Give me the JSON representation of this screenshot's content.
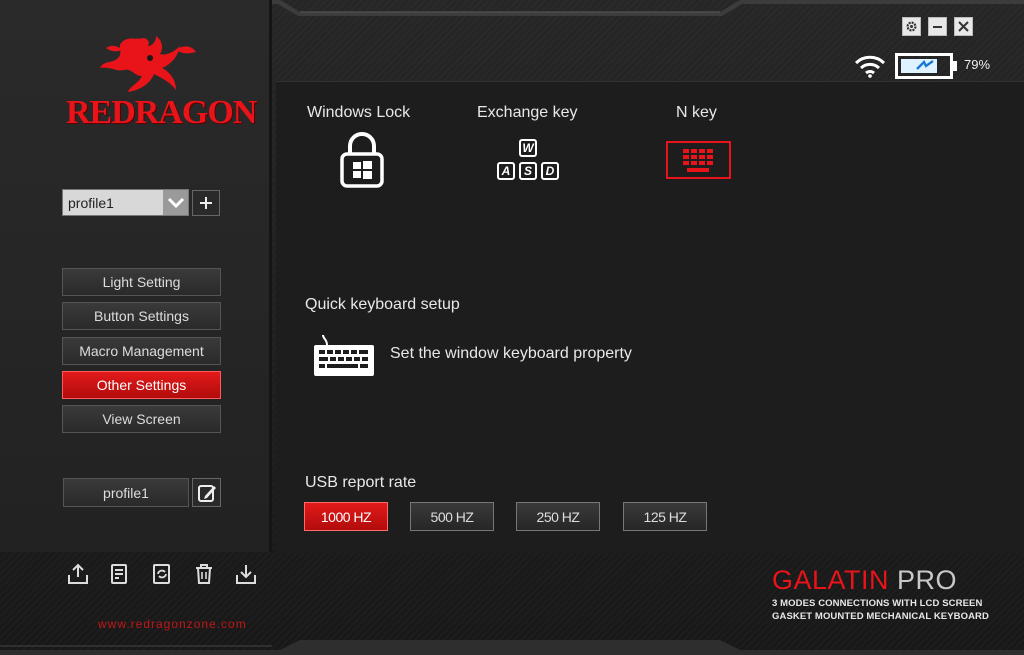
{
  "brand": {
    "name": "REDRAGON",
    "url": "www.redragonzone.com"
  },
  "profile_select": {
    "value": "profile1"
  },
  "nav": [
    {
      "label": "Light Setting",
      "active": false
    },
    {
      "label": "Button Settings",
      "active": false
    },
    {
      "label": "Macro Management",
      "active": false
    },
    {
      "label": "Other Settings",
      "active": true
    },
    {
      "label": "View Screen",
      "active": false
    }
  ],
  "profile_name": "profile1",
  "battery": {
    "percent_text": "79%",
    "level": 0.79
  },
  "features": {
    "windows_lock": "Windows Lock",
    "exchange_key": "Exchange key",
    "n_key": "N key",
    "wasd": [
      "W",
      "A",
      "S",
      "D"
    ]
  },
  "quick_setup": {
    "title": "Quick keyboard setup",
    "description": "Set the window keyboard property"
  },
  "usb_rate": {
    "title": "USB report rate",
    "options": [
      {
        "label": "1000 HZ",
        "active": true
      },
      {
        "label": "500 HZ",
        "active": false
      },
      {
        "label": "250 HZ",
        "active": false
      },
      {
        "label": "125 HZ",
        "active": false
      }
    ]
  },
  "product": {
    "name": "GALATIN",
    "suffix": "PRO",
    "tagline1": "3 MODES CONNECTIONS WITH LCD SCREEN",
    "tagline2": "GASKET MOUNTED MECHANICAL KEYBOARD"
  },
  "colors": {
    "accent": "#e21a1a",
    "background": "#1d1d1d"
  },
  "icons": [
    "dragon-logo-icon",
    "chevron-down-icon",
    "plus-icon",
    "edit-icon",
    "export-icon",
    "notes-icon",
    "refresh-icon",
    "trash-icon",
    "import-icon",
    "gear-icon",
    "minimize-icon",
    "close-icon",
    "wifi-icon",
    "battery-icon",
    "lock-windows-icon",
    "wasd-keys-icon",
    "keyboard-icon"
  ]
}
